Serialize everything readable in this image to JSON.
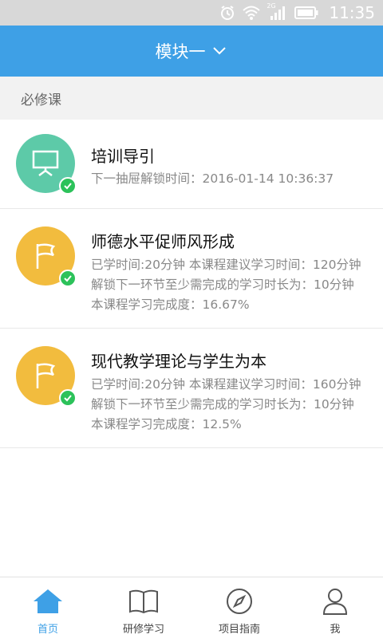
{
  "status_bar": {
    "network": "2G",
    "time": "11:35"
  },
  "header": {
    "title": "模块一"
  },
  "section": {
    "title": "必修课"
  },
  "courses": [
    {
      "title": "培训导引",
      "desc": "下一抽屉解锁时间：2016-01-14 10:36:37",
      "icon": "presentation-board-icon",
      "status": "completed"
    },
    {
      "title": "师德水平促师风形成",
      "desc": "已学时间:20分钟 本课程建议学习时间：120分钟 解锁下一环节至少需完成的学习时长为：10分钟 本课程学习完成度：16.67%",
      "icon": "flag-icon",
      "status": "completed"
    },
    {
      "title": "现代教学理论与学生为本",
      "desc": "已学时间:20分钟 本课程建议学习时间：160分钟 解锁下一环节至少需完成的学习时长为：10分钟 本课程学习完成度：12.5%",
      "icon": "flag-icon",
      "status": "completed"
    }
  ],
  "bottom_nav": [
    {
      "label": "首页",
      "icon": "home-icon",
      "active": true
    },
    {
      "label": "研修学习",
      "icon": "book-icon",
      "active": false
    },
    {
      "label": "项目指南",
      "icon": "compass-icon",
      "active": false
    },
    {
      "label": "我",
      "icon": "user-icon",
      "active": false
    }
  ],
  "colors": {
    "primary": "#3ea0e6",
    "green_icon": "#5dcaa8",
    "yellow_icon": "#f2bc3e",
    "check": "#2cc25a"
  }
}
